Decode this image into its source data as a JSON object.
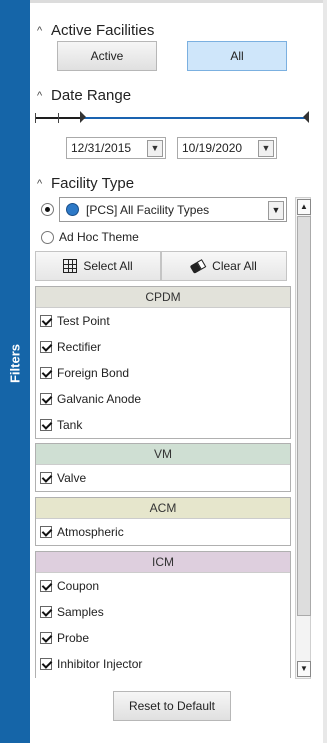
{
  "sidebar": {
    "tab_label": "Filters",
    "color": "#1565a8"
  },
  "active_facilities": {
    "title": "Active Facilities",
    "buttons": [
      {
        "label": "Active",
        "selected": false
      },
      {
        "label": "All",
        "selected": true
      }
    ]
  },
  "date_range": {
    "title": "Date Range",
    "start": "12/31/2015",
    "end": "10/19/2020"
  },
  "facility_type": {
    "title": "Facility Type",
    "selected_option": "[PCS] All Facility Types",
    "ad_hoc_label": "Ad Hoc Theme",
    "select_all_label": "Select All",
    "clear_all_label": "Clear All"
  },
  "groups": [
    {
      "name": "CPDM",
      "color": "#e2e2da",
      "items": [
        "Test Point",
        "Rectifier",
        "Foreign Bond",
        "Galvanic Anode",
        "Tank"
      ]
    },
    {
      "name": "VM",
      "color": "#cfdfd3",
      "items": [
        "Valve"
      ]
    },
    {
      "name": "ACM",
      "color": "#e6e6cc",
      "items": [
        "Atmospheric"
      ]
    },
    {
      "name": "ICM",
      "color": "#decfde",
      "items": [
        "Coupon",
        "Samples",
        "Probe",
        "Inhibitor Injector"
      ]
    }
  ],
  "reset_label": "Reset to Default"
}
